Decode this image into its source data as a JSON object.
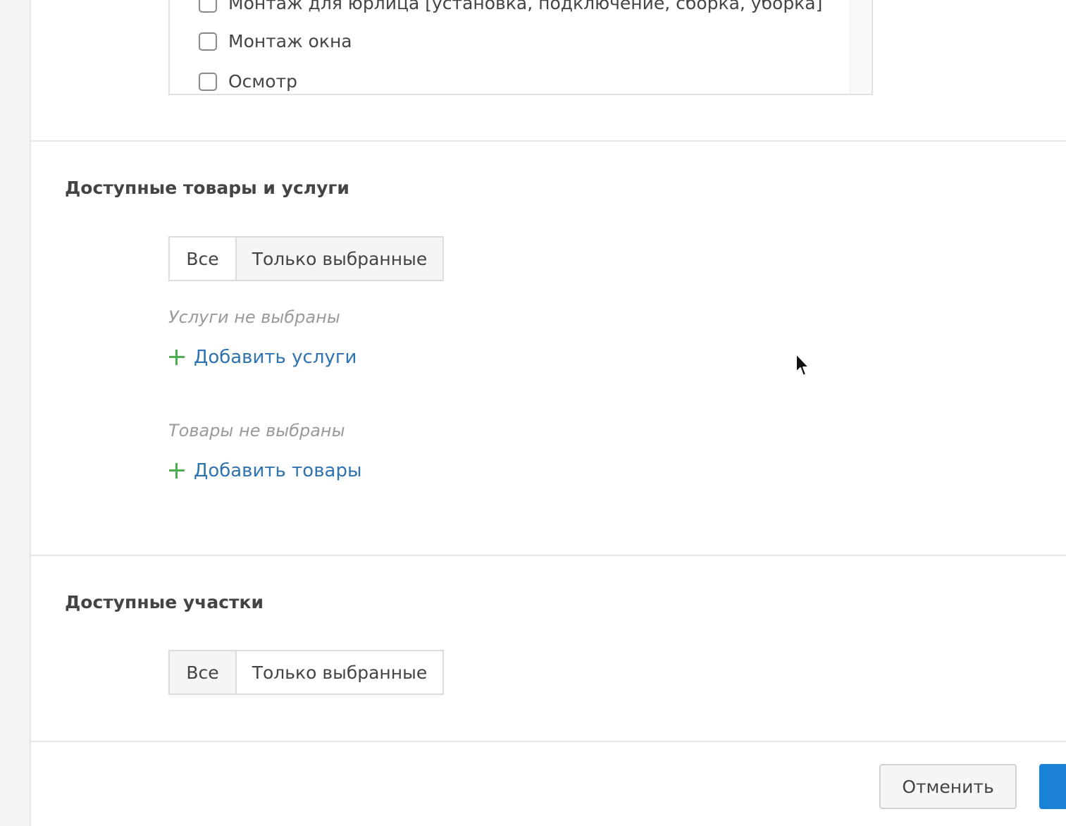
{
  "service_list": {
    "items": [
      {
        "label": "Монтаж для юрлица [установка, подключение, сборка, уборка]",
        "checked": false
      },
      {
        "label": "Монтаж окна",
        "checked": false
      },
      {
        "label": "Осмотр",
        "checked": false
      }
    ]
  },
  "section_products": {
    "title": "Доступные товары и услуги",
    "toggle": {
      "all_label": "Все",
      "selected_label": "Только выбранные",
      "active": "selected"
    },
    "services_empty": "Услуги не выбраны",
    "add_services_label": "Добавить услуги",
    "goods_empty": "Товары не выбраны",
    "add_goods_label": "Добавить товары"
  },
  "section_areas": {
    "title": "Доступные участки",
    "toggle": {
      "all_label": "Все",
      "selected_label": "Только выбранные",
      "active": "all"
    }
  },
  "footer": {
    "cancel_label": "Отменить"
  },
  "colors": {
    "link": "#2f73b0",
    "plus": "#4cae4c",
    "primary": "#1a82d4"
  }
}
